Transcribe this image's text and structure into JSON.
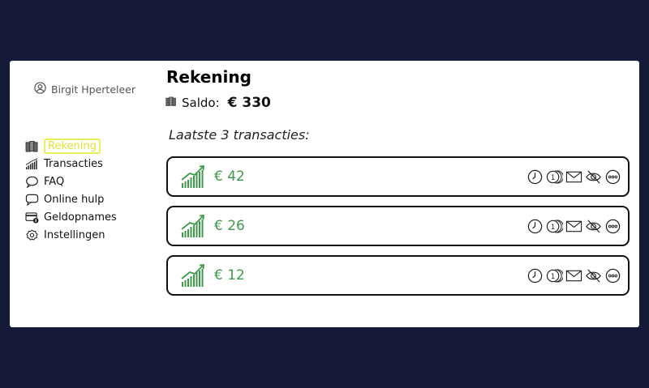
{
  "user": {
    "name": "Birgit Hperteleer",
    "icon": "user-circle-icon"
  },
  "nav": [
    {
      "label": "Rekening",
      "icon": "wallet-icon",
      "active": true
    },
    {
      "label": "Transacties",
      "icon": "bar-chart-icon"
    },
    {
      "label": "FAQ",
      "icon": "speech-bubble-icon"
    },
    {
      "label": "Online hulp",
      "icon": "chat-icon"
    },
    {
      "label": "Geldopnames",
      "icon": "card-withdraw-icon"
    },
    {
      "label": "Instellingen",
      "icon": "gear-icon"
    }
  ],
  "page": {
    "title": "Rekening",
    "saldo_label": "Saldo:",
    "saldo_amount": "€ 330",
    "subtitle": "Laatste  3 transacties:"
  },
  "transactions": [
    {
      "amount": "€ 42"
    },
    {
      "amount": "€ 26"
    },
    {
      "amount": "€ 12"
    }
  ],
  "transaction_actions": [
    "clock-icon",
    "coins-icon",
    "mail-icon",
    "hide-icon",
    "more-icon"
  ],
  "colors": {
    "background": "#141a38",
    "card": "#ffffff",
    "active_highlight": "#e8ef5a",
    "amount_green": "#3e9a4a"
  }
}
